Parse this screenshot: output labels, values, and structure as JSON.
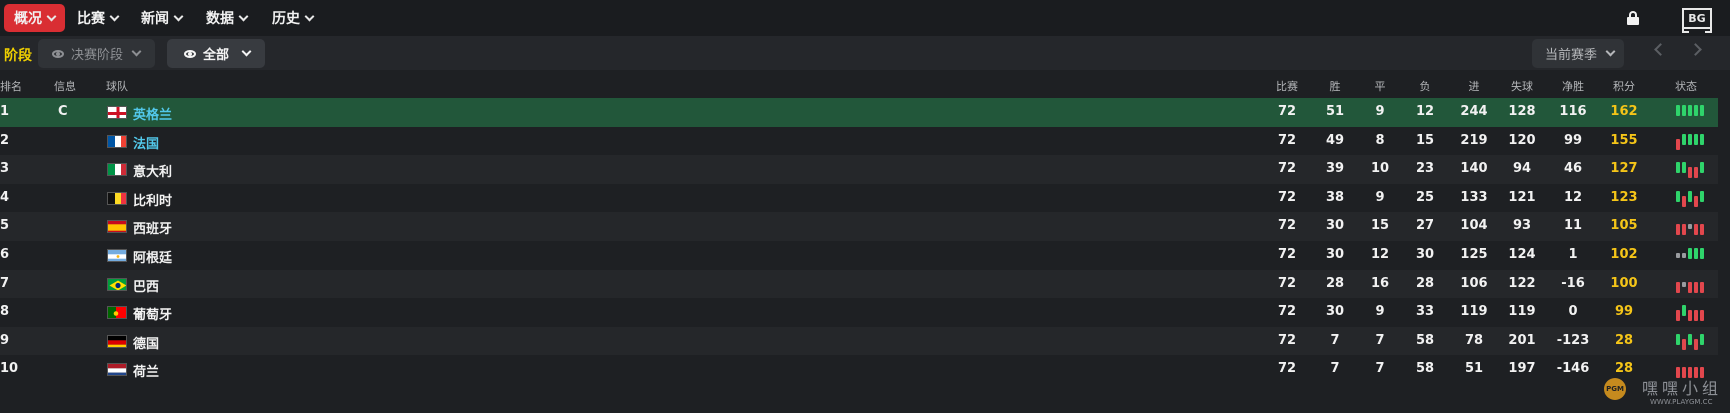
{
  "nav": {
    "items": [
      {
        "label": "概况",
        "active": true
      },
      {
        "label": "比赛"
      },
      {
        "label": "新闻"
      },
      {
        "label": "数据"
      },
      {
        "label": "历史"
      }
    ],
    "logo": "BG"
  },
  "filters": {
    "stage_label": "阶段",
    "stage_dropdown": "决赛阶段",
    "view_dropdown": "全部",
    "season_dropdown": "当前赛季"
  },
  "table": {
    "columns": {
      "rank": "排名",
      "info": "信息",
      "team": "球队",
      "played": "比赛",
      "won": "胜",
      "drawn": "平",
      "lost": "负",
      "gf": "进",
      "ga": "失球",
      "gd": "净胜",
      "pts": "积分",
      "form": "状态"
    },
    "rows": [
      {
        "rank": "1",
        "info": "C",
        "team": "英格兰",
        "flag": "england",
        "played": "72",
        "won": "51",
        "drawn": "9",
        "lost": "12",
        "gf": "244",
        "ga": "128",
        "gd": "116",
        "pts": "162",
        "form": [
          "W",
          "W",
          "W",
          "W",
          "W"
        ]
      },
      {
        "rank": "2",
        "info": "",
        "team": "法国",
        "flag": "france",
        "played": "72",
        "won": "49",
        "drawn": "8",
        "lost": "15",
        "gf": "219",
        "ga": "120",
        "gd": "99",
        "pts": "155",
        "form": [
          "L",
          "W",
          "W",
          "W",
          "W"
        ]
      },
      {
        "rank": "3",
        "info": "",
        "team": "意大利",
        "flag": "italy",
        "played": "72",
        "won": "39",
        "drawn": "10",
        "lost": "23",
        "gf": "140",
        "ga": "94",
        "gd": "46",
        "pts": "127",
        "form": [
          "W",
          "W",
          "L",
          "L",
          "W"
        ]
      },
      {
        "rank": "4",
        "info": "",
        "team": "比利时",
        "flag": "belgium",
        "played": "72",
        "won": "38",
        "drawn": "9",
        "lost": "25",
        "gf": "133",
        "ga": "121",
        "gd": "12",
        "pts": "123",
        "form": [
          "W",
          "L",
          "W",
          "L",
          "W"
        ]
      },
      {
        "rank": "5",
        "info": "",
        "team": "西班牙",
        "flag": "spain",
        "played": "72",
        "won": "30",
        "drawn": "15",
        "lost": "27",
        "gf": "104",
        "ga": "93",
        "gd": "11",
        "pts": "105",
        "form": [
          "L",
          "L",
          "D",
          "L",
          "L"
        ]
      },
      {
        "rank": "6",
        "info": "",
        "team": "阿根廷",
        "flag": "argentina",
        "played": "72",
        "won": "30",
        "drawn": "12",
        "lost": "30",
        "gf": "125",
        "ga": "124",
        "gd": "1",
        "pts": "102",
        "form": [
          "D",
          "D",
          "W",
          "W",
          "W"
        ]
      },
      {
        "rank": "7",
        "info": "",
        "team": "巴西",
        "flag": "brazil",
        "played": "72",
        "won": "28",
        "drawn": "16",
        "lost": "28",
        "gf": "106",
        "ga": "122",
        "gd": "-16",
        "pts": "100",
        "form": [
          "L",
          "D",
          "L",
          "L",
          "L"
        ]
      },
      {
        "rank": "8",
        "info": "",
        "team": "葡萄牙",
        "flag": "portugal",
        "played": "72",
        "won": "30",
        "drawn": "9",
        "lost": "33",
        "gf": "119",
        "ga": "119",
        "gd": "0",
        "pts": "99",
        "form": [
          "L",
          "W",
          "L",
          "L",
          "L"
        ]
      },
      {
        "rank": "9",
        "info": "",
        "team": "德国",
        "flag": "germany",
        "played": "72",
        "won": "7",
        "drawn": "7",
        "lost": "58",
        "gf": "78",
        "ga": "201",
        "gd": "-123",
        "pts": "28",
        "form": [
          "W",
          "L",
          "W",
          "L",
          "W"
        ]
      },
      {
        "rank": "10",
        "info": "",
        "team": "荷兰",
        "flag": "netherlands",
        "played": "72",
        "won": "7",
        "drawn": "7",
        "lost": "58",
        "gf": "51",
        "ga": "197",
        "gd": "-146",
        "pts": "28",
        "form": [
          "L",
          "L",
          "L",
          "L",
          "L"
        ]
      }
    ]
  },
  "colors": {
    "accent": "#d92e33",
    "highlight_row": "#22573a",
    "points": "#f5c518",
    "team_link": "#52c8ea",
    "form_win": "#2fd46b",
    "form_loss": "#e2474d",
    "form_draw": "#9a9ca0"
  },
  "watermark": {
    "text": "嘿嘿小组",
    "url": "WWW.PLAYGM.CC",
    "badge": "PGM"
  }
}
